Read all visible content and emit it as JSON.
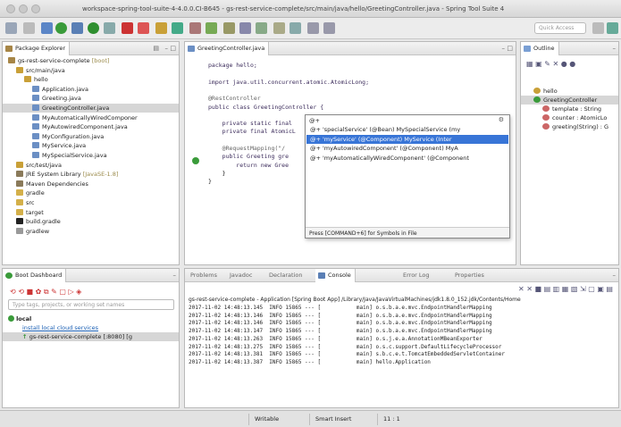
{
  "window": {
    "title": "workspace-spring-tool-suite-4-4.0.0.CI-B645 - gs-rest-service-complete/src/main/java/hello/GreetingController.java - Spring Tool Suite 4"
  },
  "toolbar": {
    "quick_access_placeholder": "Quick Access"
  },
  "package_explorer": {
    "tab_label": "Package Explorer",
    "tab2_label": "",
    "tree": [
      {
        "label": "gs-rest-service-complete",
        "suffix": " [boot]",
        "indent": 0,
        "icon": "project-icon"
      },
      {
        "label": "src/main/java",
        "indent": 1,
        "icon": "source-folder-icon"
      },
      {
        "label": "hello",
        "indent": 2,
        "icon": "package-icon"
      },
      {
        "label": "Application.java",
        "indent": 3,
        "icon": "java-file-icon"
      },
      {
        "label": "Greeting.java",
        "indent": 3,
        "icon": "java-file-icon"
      },
      {
        "label": "GreetingController.java",
        "indent": 3,
        "icon": "java-file-icon",
        "selected": true
      },
      {
        "label": "MyAutomaticallyWiredComponer",
        "indent": 3,
        "icon": "java-file-icon"
      },
      {
        "label": "MyAutowiredComponent.java",
        "indent": 3,
        "icon": "java-file-icon"
      },
      {
        "label": "MyConfiguration.java",
        "indent": 3,
        "icon": "java-file-icon"
      },
      {
        "label": "MyService.java",
        "indent": 3,
        "icon": "java-file-icon"
      },
      {
        "label": "MySpecialService.java",
        "indent": 3,
        "icon": "java-file-icon"
      },
      {
        "label": "src/test/java",
        "indent": 1,
        "icon": "source-folder-icon"
      },
      {
        "label": "JRE System Library",
        "suffix": " [JavaSE-1.8]",
        "indent": 1,
        "icon": "library-icon"
      },
      {
        "label": "Maven Dependencies",
        "indent": 1,
        "icon": "library-icon"
      },
      {
        "label": "gradle",
        "indent": 1,
        "icon": "folder-icon"
      },
      {
        "label": "src",
        "indent": 1,
        "icon": "folder-icon"
      },
      {
        "label": "target",
        "indent": 1,
        "icon": "folder-icon"
      },
      {
        "label": "build.gradle",
        "indent": 1,
        "icon": "gradle-file-icon"
      },
      {
        "label": "gradlew",
        "indent": 1,
        "icon": "file-icon"
      }
    ]
  },
  "editor": {
    "tab_label": "GreetingController.java",
    "lines": [
      {
        "t": "package hello;",
        "cls": "pkg"
      },
      {
        "t": "",
        "cls": ""
      },
      {
        "t": "import java.util.concurrent.atomic.AtomicLong;",
        "cls": "imp"
      },
      {
        "t": "",
        "cls": ""
      },
      {
        "t": "@RestController",
        "cls": "an"
      },
      {
        "t": "public class GreetingController {",
        "cls": "cls"
      },
      {
        "t": "",
        "cls": ""
      },
      {
        "t": "    private static final",
        "cls": "fld"
      },
      {
        "t": "    private final AtomicL",
        "cls": "fld"
      },
      {
        "t": "",
        "cls": ""
      },
      {
        "t": "    @RequestMapping(\"/",
        "cls": "an"
      },
      {
        "t": "    public Greeting gre",
        "cls": "m"
      },
      {
        "t": "        return new Gree",
        "cls": "r"
      },
      {
        "t": "    }",
        "cls": ""
      },
      {
        "t": "}",
        "cls": ""
      }
    ]
  },
  "content_assist": {
    "input": "@+",
    "items": [
      "@+ 'specialService' (@Bean) MySpecialService (my",
      "@+ 'myService' (@Component) MyService (Inter",
      "@+ 'myAutowiredComponent' (@Component) MyA",
      "@+ 'myAutomaticallyWiredComponent' (@Component"
    ],
    "selected_index": 1,
    "footer": "Press [COMMAND+6] for Symbols in File"
  },
  "outline": {
    "tab_label": "Outline",
    "items": [
      {
        "label": "hello",
        "indent": 0
      },
      {
        "label": "GreetingController",
        "indent": 0,
        "selected": true
      },
      {
        "label": "template : String",
        "indent": 1
      },
      {
        "label": "counter : AtomicLo",
        "indent": 1
      },
      {
        "label": "greeting(String) : G",
        "indent": 1
      }
    ]
  },
  "boot_dashboard": {
    "tab_label": "Boot Dashboard",
    "filter_placeholder": "Type tags, projects, or working set names",
    "local_label": "local",
    "link_label": "install local cloud services",
    "app_label": "gs-rest-service-complete [:8080] [g"
  },
  "bottom_tabs": {
    "problems": "Problems",
    "javadoc": "Javadoc",
    "declaration": "Declaration",
    "console": "Console",
    "error_log": "Error Log",
    "properties": "Properties"
  },
  "console": {
    "header": "gs-rest-service-complete - Application [Spring Boot App] /Library/Java/JavaVirtualMachines/jdk1.8.0_152.jdk/Contents/Home",
    "lines": [
      "2017-11-02 14:48:13.145  INFO 15865 --- [           main] o.s.b.a.e.mvc.EndpointHandlerMapping",
      "2017-11-02 14:48:13.146  INFO 15865 --- [           main] o.s.b.a.e.mvc.EndpointHandlerMapping",
      "2017-11-02 14:48:13.146  INFO 15865 --- [           main] o.s.b.a.e.mvc.EndpointHandlerMapping",
      "2017-11-02 14:48:13.147  INFO 15865 --- [           main] o.s.b.a.e.mvc.EndpointHandlerMapping",
      "2017-11-02 14:48:13.263  INFO 15865 --- [           main] o.s.j.e.a.AnnotationMBeanExporter",
      "2017-11-02 14:48:13.275  INFO 15865 --- [           main] o.s.c.support.DefaultLifecycleProcessor",
      "2017-11-02 14:48:13.381  INFO 15865 --- [           main] s.b.c.e.t.TomcatEmbeddedServletContainer",
      "2017-11-02 14:48:13.387  INFO 15865 --- [           main] hello.Application"
    ]
  },
  "status": {
    "writable": "Writable",
    "insert_mode": "Smart Insert",
    "position": "11 : 1"
  }
}
